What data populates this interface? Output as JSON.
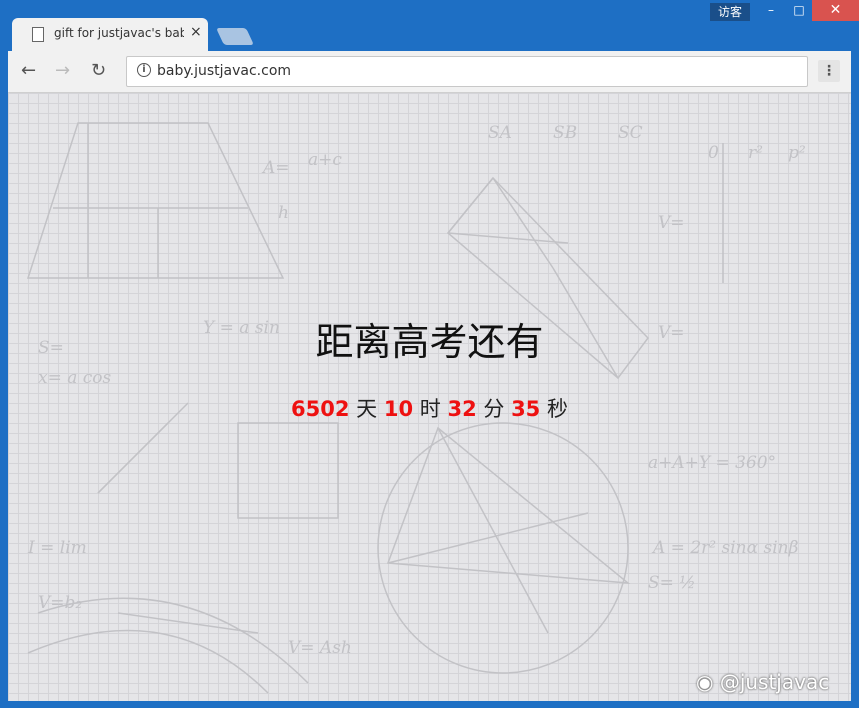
{
  "window": {
    "guest_label": "访客",
    "minimize_glyph": "–",
    "maximize_glyph": "□",
    "close_glyph": "✕"
  },
  "tab": {
    "title": "gift for justjavac's baby",
    "close_glyph": "×"
  },
  "toolbar": {
    "back_glyph": "←",
    "forward_glyph": "→",
    "reload_glyph": "↻",
    "info_glyph": "i",
    "url": "baby.justjavac.com",
    "menu_glyph": "⋮"
  },
  "page": {
    "heading": "距离高考还有",
    "days": "6502",
    "days_unit": "天",
    "hours": "10",
    "hours_unit": "时",
    "minutes": "32",
    "minutes_unit": "分",
    "seconds": "35",
    "seconds_unit": "秒",
    "watermark": "@justjavac"
  },
  "colors": {
    "titlebar": "#1e6fc4",
    "countdown_number": "#ee1111",
    "background": "#e5e5e8"
  }
}
